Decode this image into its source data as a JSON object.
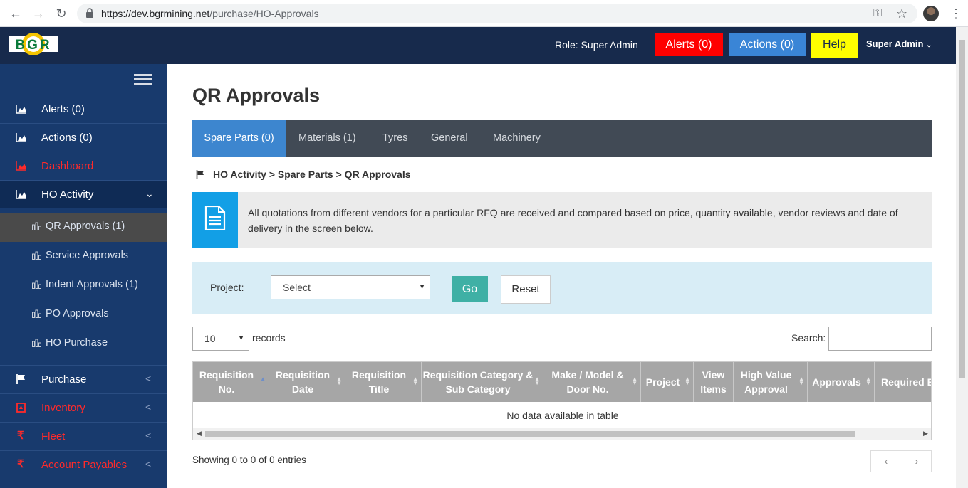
{
  "browser": {
    "url_host": "https://dev.bgrmining.net",
    "url_path": "/purchase/HO-Approvals"
  },
  "header": {
    "logo_text": "BGR",
    "role": "Role: Super Admin",
    "alerts": "Alerts (0)",
    "actions": "Actions (0)",
    "help": "Help",
    "user": "Super Admin"
  },
  "sidebar": {
    "items": [
      {
        "label": "Alerts (0)"
      },
      {
        "label": "Actions (0)"
      },
      {
        "label": "Dashboard"
      },
      {
        "label": "HO Activity"
      },
      {
        "label": "Purchase"
      },
      {
        "label": "Inventory"
      },
      {
        "label": "Fleet"
      },
      {
        "label": "Account Payables"
      }
    ],
    "sub_items": [
      {
        "label": "QR Approvals (1)"
      },
      {
        "label": "Service Approvals"
      },
      {
        "label": "Indent Approvals (1)"
      },
      {
        "label": "PO Approvals"
      },
      {
        "label": "HO Purchase"
      }
    ],
    "colors": {
      "red_item": "#ff2a2a",
      "bg": "#183a6d"
    }
  },
  "main": {
    "title": "QR Approvals",
    "tabs": [
      {
        "label": "Spare Parts (0)"
      },
      {
        "label": "Materials (1)"
      },
      {
        "label": "Tyres"
      },
      {
        "label": "General"
      },
      {
        "label": "Machinery"
      }
    ],
    "breadcrumb": "HO Activity > Spare Parts > QR Approvals",
    "info": "All quotations from different vendors for a particular RFQ are received and compared based on price, quantity available, vendor reviews and date of delivery in the screen below.",
    "filter": {
      "project_label": "Project:",
      "project_value": "Select",
      "go": "Go",
      "reset": "Reset"
    },
    "table": {
      "length_value": "10",
      "length_label": "records",
      "search_label": "Search:",
      "columns": [
        "Requisition No.",
        "Requisition Date",
        "Requisition Title",
        "Requisition Category & Sub Category",
        "Make / Model & Door No.",
        "Project",
        "View Items",
        "High Value Approval",
        "Approvals",
        "Required B"
      ],
      "empty_text": "No data available in table",
      "info": "Showing 0 to 0 of 0 entries"
    }
  }
}
